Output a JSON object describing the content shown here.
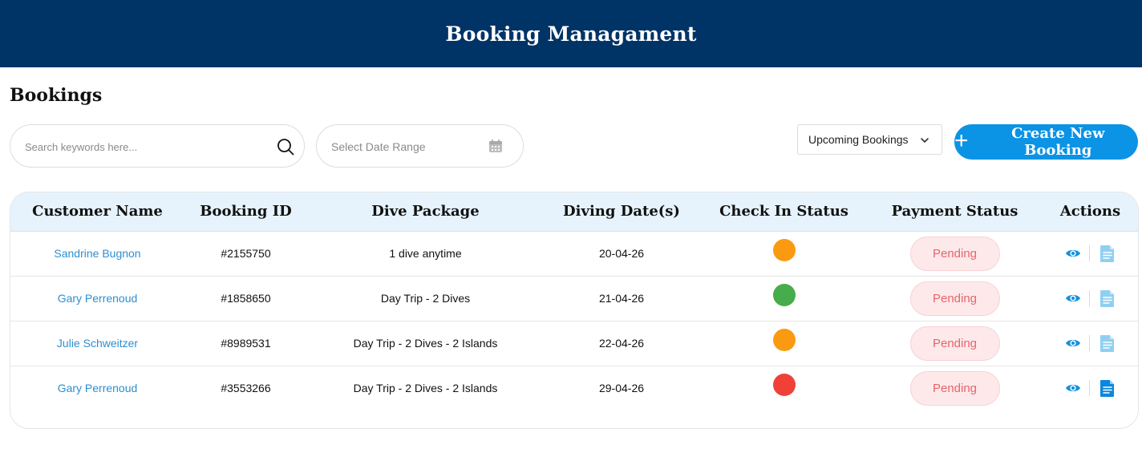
{
  "header": {
    "title": "Booking Managament"
  },
  "section": {
    "title": "Bookings"
  },
  "search": {
    "placeholder": "Search keywords here...",
    "icon": "search-icon"
  },
  "date_range": {
    "placeholder": "Select Date Range",
    "icon": "calendar-icon"
  },
  "filter": {
    "selected": "Upcoming Bookings",
    "icon": "chevron-down-icon"
  },
  "create_button": {
    "label": "Create New Booking",
    "icon": "plus-icon",
    "color": "#0b93e5"
  },
  "colors": {
    "header_bg": "#003366",
    "name_link": "#2d8fd0",
    "pending_text": "#e8646c",
    "pending_bg": "#fde9ea"
  },
  "table": {
    "columns": [
      "Customer Name",
      "Booking ID",
      "Dive Package",
      "Diving Date(s)",
      "Check In Status",
      "Payment Status",
      "Actions"
    ],
    "rows": [
      {
        "customer": "Sandrine Bugnon",
        "booking_id": "#2155750",
        "package": "1 dive anytime",
        "date": "20-04-26",
        "checkin_color": "#f99a11",
        "payment": "Pending",
        "doc_color": "#8fd0f2"
      },
      {
        "customer": "Gary Perrenoud",
        "booking_id": "#1858650",
        "package": "Day Trip - 2 Dives",
        "date": "21-04-26",
        "checkin_color": "#47ac4b",
        "payment": "Pending",
        "doc_color": "#8fd0f2"
      },
      {
        "customer": "Julie Schweitzer",
        "booking_id": "#8989531",
        "package": "Day Trip - 2 Dives - 2 Islands",
        "date": "22-04-26",
        "checkin_color": "#f99a11",
        "payment": "Pending",
        "doc_color": "#8fd0f2"
      },
      {
        "customer": "Gary Perrenoud",
        "booking_id": "#3553266",
        "package": "Day Trip - 2 Dives - 2 Islands",
        "date": "29-04-26",
        "checkin_color": "#ef4138",
        "payment": "Pending",
        "doc_color": "#0b88dd"
      }
    ]
  }
}
